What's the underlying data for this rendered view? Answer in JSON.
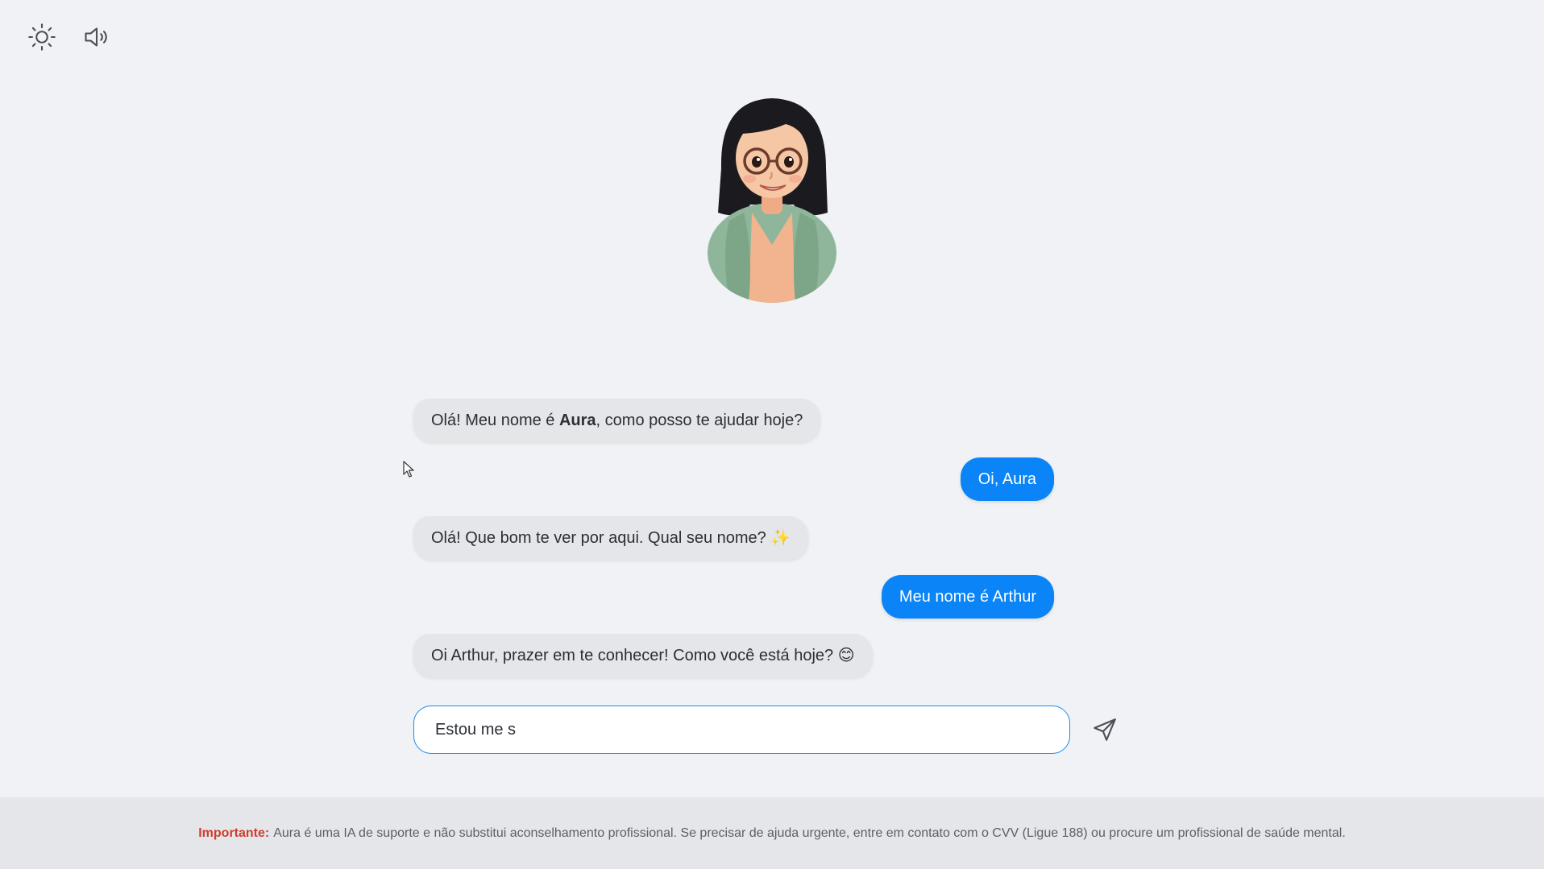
{
  "controls": {
    "theme_icon": "sun-icon",
    "sound_icon": "speaker-icon"
  },
  "avatar": {
    "alt": "Aura"
  },
  "messages": [
    {
      "from": "bot",
      "parts": [
        "Olá! Meu nome é ",
        "Aura",
        ", como posso te ajudar hoje?"
      ]
    },
    {
      "from": "user",
      "text": "Oi, Aura"
    },
    {
      "from": "bot",
      "text": "Olá! Que bom te ver por aqui. Qual seu nome? ✨"
    },
    {
      "from": "user",
      "text": "Meu nome é Arthur"
    },
    {
      "from": "bot",
      "text": "Oi Arthur, prazer em te conhecer! Como você está hoje? 😊"
    }
  ],
  "composer": {
    "value": "Estou me s",
    "send_icon": "send-icon"
  },
  "footer": {
    "label": "Importante:",
    "text": "Aura é uma IA de suporte e não substitui aconselhamento profissional. Se precisar de ajuda urgente, entre em contato com o CVV (Ligue 188) ou procure um profissional de saúde mental."
  },
  "colors": {
    "background": "#f0f2f5",
    "bot_bubble": "#e4e6e9",
    "user_bubble": "#0a84f6",
    "input_border": "#1a8bf2",
    "warning": "#d23c2e"
  }
}
